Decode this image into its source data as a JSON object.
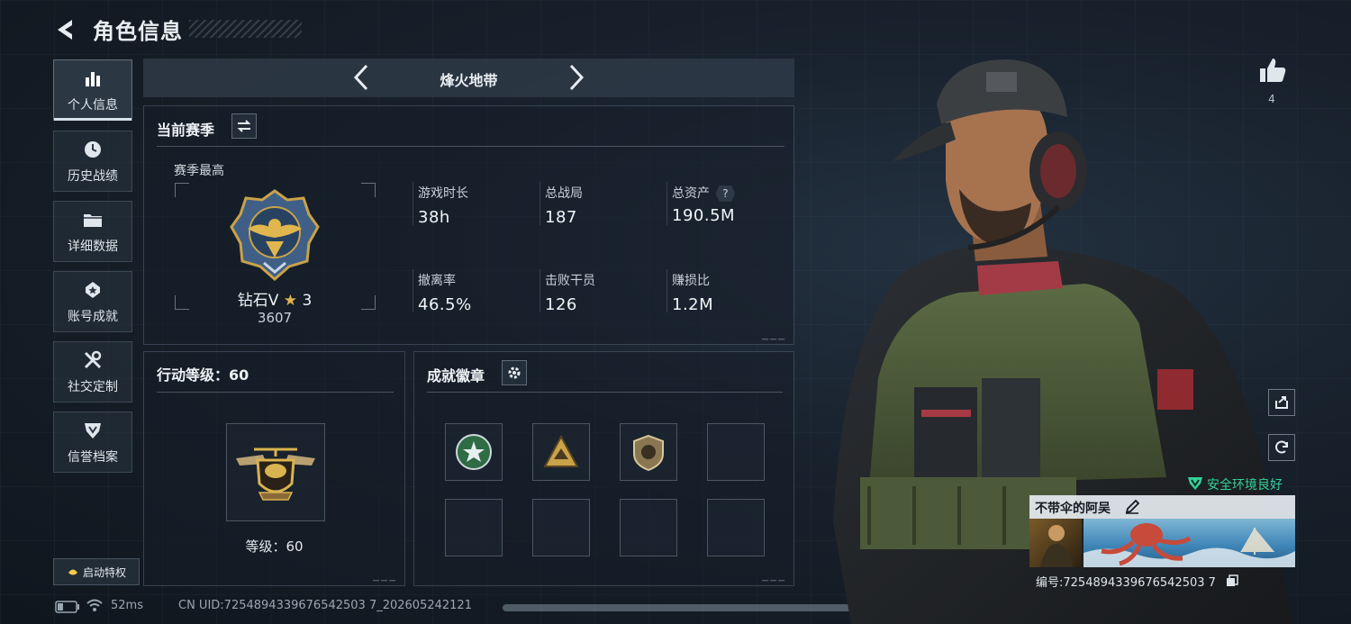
{
  "header": {
    "title": "角色信息"
  },
  "nav": {
    "items": [
      {
        "label": "个人信息",
        "icon": "bar-chart-icon",
        "active": true
      },
      {
        "label": "历史战绩",
        "icon": "clock-icon",
        "active": false
      },
      {
        "label": "详细数据",
        "icon": "folder-icon",
        "active": false
      },
      {
        "label": "账号成就",
        "icon": "medal-icon",
        "active": false
      },
      {
        "label": "社交定制",
        "icon": "tools-icon",
        "active": false
      },
      {
        "label": "信誉档案",
        "icon": "shield-icon",
        "active": false
      }
    ],
    "perk_label": "启动特权"
  },
  "mode": {
    "name": "烽火地带"
  },
  "season": {
    "title": "当前赛季",
    "best_label": "赛季最高",
    "rank_name": "钻石V",
    "rank_stars": "3",
    "rank_points": "3607",
    "stats": [
      {
        "label": "游戏时长",
        "value": "38h",
        "help": false
      },
      {
        "label": "总战局",
        "value": "187",
        "help": false
      },
      {
        "label": "总资产",
        "value": "190.5M",
        "help": true
      },
      {
        "label": "撤离率",
        "value": "46.5%",
        "help": false
      },
      {
        "label": "击败干员",
        "value": "126",
        "help": false
      },
      {
        "label": "赚损比",
        "value": "1.2M",
        "help": false
      }
    ]
  },
  "action_level": {
    "title": "行动等级：60",
    "level_label": "等级：60"
  },
  "achievements": {
    "title": "成就徽章",
    "filled_slots": 3,
    "total_slots": 8
  },
  "status_bar": {
    "ping": "52ms",
    "uid": "CN UID:7254894339676542503 7_202605242121"
  },
  "character": {
    "like_count": "4",
    "safe_env": "安全环境良好",
    "player_name": "不带伞的阿吴",
    "player_id": "编号:7254894339676542503 7"
  },
  "colors": {
    "accent_green": "#34d399",
    "panel_border": "#5b6b7a",
    "gold": "#c9a24a"
  }
}
